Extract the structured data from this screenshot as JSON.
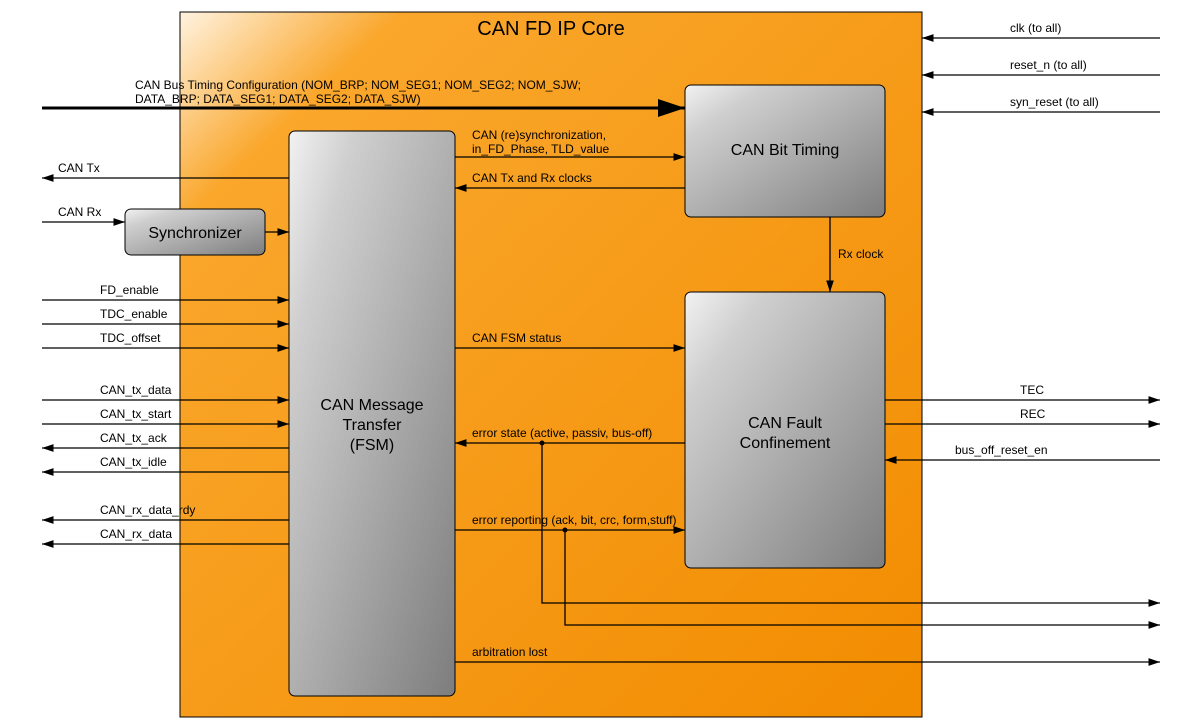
{
  "core": {
    "title": "CAN FD IP Core"
  },
  "blocks": {
    "sync": "Synchronizer",
    "fsm_l1": "CAN Message",
    "fsm_l2": "Transfer",
    "fsm_l3": "(FSM)",
    "bittiming": "CAN Bit Timing",
    "fault_l1": "CAN Fault",
    "fault_l2": "Confinement"
  },
  "signals": {
    "clk": "clk (to all)",
    "reset_n": "reset_n (to all)",
    "syn_reset": "syn_reset (to all)",
    "bus_timing_l1": "CAN Bus Timing Configuration (NOM_BRP; NOM_SEG1; NOM_SEG2; NOM_SJW;",
    "bus_timing_l2": "DATA_BRP; DATA_SEG1; DATA_SEG2; DATA_SJW)",
    "can_tx": "CAN Tx",
    "can_rx": "CAN Rx",
    "fd_enable": "FD_enable",
    "tdc_enable": "TDC_enable",
    "tdc_offset": "TDC_offset",
    "can_tx_data": "CAN_tx_data",
    "can_tx_start": "CAN_tx_start",
    "can_tx_ack": "CAN_tx_ack",
    "can_tx_idle": "CAN_tx_idle",
    "can_rx_data_rdy": "CAN_rx_data_rdy",
    "can_rx_data": "CAN_rx_data",
    "resync_l1": "CAN (re)synchronization,",
    "resync_l2": "in_FD_Phase, TLD_value",
    "txrx_clocks": "CAN Tx and Rx clocks",
    "rx_clock": "Rx clock",
    "fsm_status": "CAN FSM status",
    "err_state": "error state (active, passiv, bus-off)",
    "err_report": "error reporting (ack, bit, crc, form,stuff)",
    "arb_lost": "arbitration lost",
    "tec": "TEC",
    "rec": "REC",
    "bus_off_reset_en": "bus_off_reset_en"
  }
}
